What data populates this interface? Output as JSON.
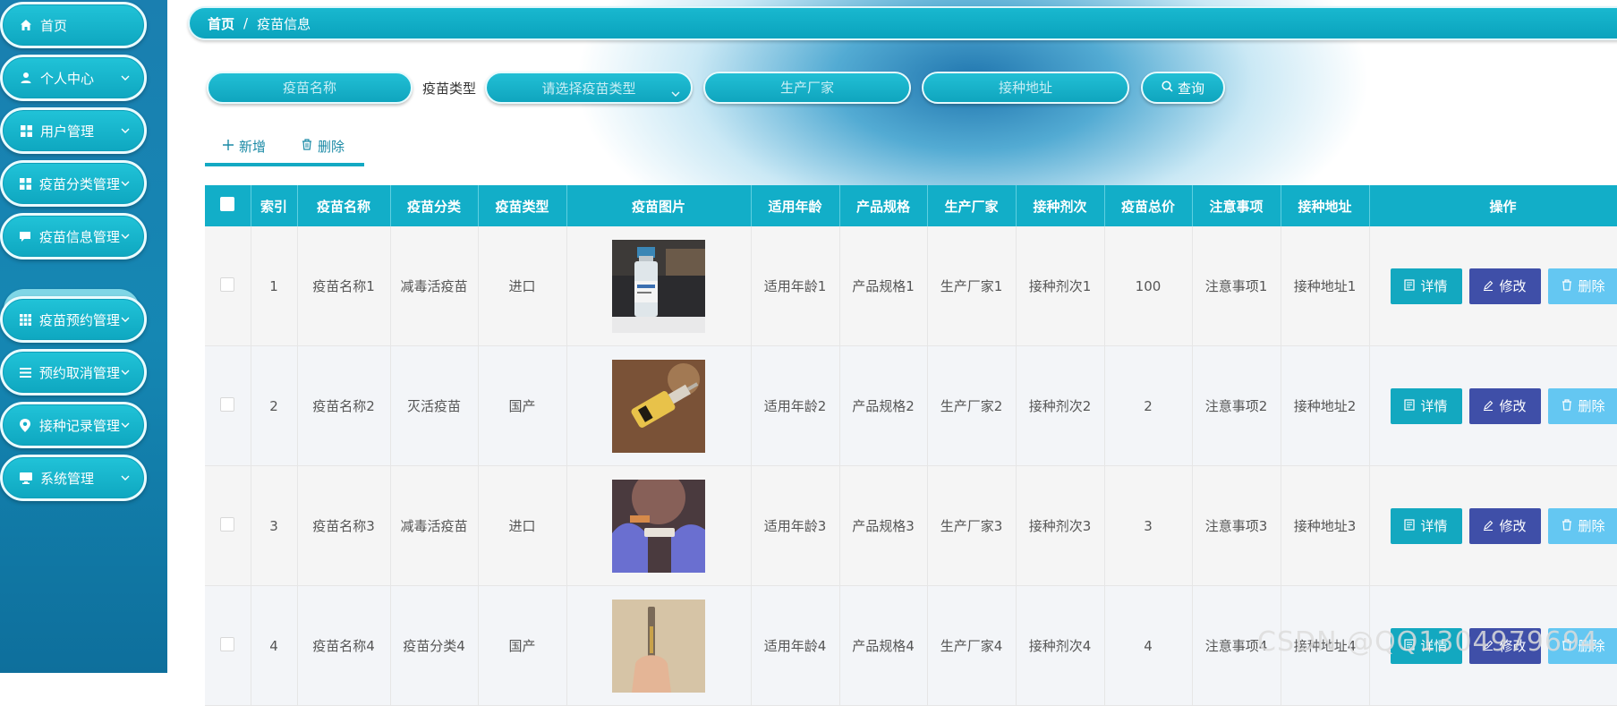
{
  "sidebar": {
    "items": [
      {
        "label": "首页",
        "icon": "home-icon",
        "has_chevron": false
      },
      {
        "label": "个人中心",
        "icon": "user-icon",
        "has_chevron": true
      },
      {
        "label": "用户管理",
        "icon": "grid-icon",
        "has_chevron": true
      },
      {
        "label": "疫苗分类管理",
        "icon": "grid-icon",
        "has_chevron": true
      },
      {
        "label": "疫苗信息管理",
        "icon": "chat-icon",
        "has_chevron": true
      },
      {
        "label": "疫苗预约管理",
        "icon": "grid9-icon",
        "has_chevron": true
      },
      {
        "label": "预约取消管理",
        "icon": "list-icon",
        "has_chevron": true
      },
      {
        "label": "接种记录管理",
        "icon": "pin-icon",
        "has_chevron": true
      },
      {
        "label": "系统管理",
        "icon": "monitor-icon",
        "has_chevron": true
      }
    ],
    "active_sub": "疫苗信息"
  },
  "breadcrumb": {
    "home": "首页",
    "separator": "/",
    "current": "疫苗信息"
  },
  "search": {
    "name_placeholder": "疫苗名称",
    "type_label": "疫苗类型",
    "type_placeholder": "请选择疫苗类型",
    "maker_placeholder": "生产厂家",
    "address_placeholder": "接种地址",
    "button": "查询"
  },
  "toolbar": {
    "add": "新增",
    "delete": "删除"
  },
  "table": {
    "headers": [
      "索引",
      "疫苗名称",
      "疫苗分类",
      "疫苗类型",
      "疫苗图片",
      "适用年龄",
      "产品规格",
      "生产厂家",
      "接种剂次",
      "疫苗总价",
      "注意事项",
      "接种地址",
      "操作"
    ],
    "actions": {
      "detail": "详情",
      "edit": "修改",
      "delete": "删除"
    },
    "rows": [
      {
        "index": "1",
        "name": "疫苗名称1",
        "category": "减毒活疫苗",
        "type": "进口",
        "image": "vaccine-vial-photo",
        "age": "适用年龄1",
        "spec": "产品规格1",
        "maker": "生产厂家1",
        "dose": "接种剂次1",
        "price": "100",
        "notes": "注意事项1",
        "address": "接种地址1"
      },
      {
        "index": "2",
        "name": "疫苗名称2",
        "category": "灭活疫苗",
        "type": "国产",
        "image": "syringe-photo",
        "age": "适用年龄2",
        "spec": "产品规格2",
        "maker": "生产厂家2",
        "dose": "接种剂次2",
        "price": "2",
        "notes": "注意事项2",
        "address": "接种地址2"
      },
      {
        "index": "3",
        "name": "疫苗名称3",
        "category": "减毒活疫苗",
        "type": "进口",
        "image": "gloved-hands-photo",
        "age": "适用年龄3",
        "spec": "产品规格3",
        "maker": "生产厂家3",
        "dose": "接种剂次3",
        "price": "3",
        "notes": "注意事项3",
        "address": "接种地址3"
      },
      {
        "index": "4",
        "name": "疫苗名称4",
        "category": "疫苗分类4",
        "type": "国产",
        "image": "hand-syringe-photo",
        "age": "适用年龄4",
        "spec": "产品规格4",
        "maker": "生产厂家4",
        "dose": "接种剂次4",
        "price": "4",
        "notes": "注意事项4",
        "address": "接种地址4"
      }
    ]
  },
  "watermark": "CSDN @QQ1304979694",
  "colors": {
    "primary": "#12aec8",
    "edit": "#3f4fa8",
    "delete": "#64c7f2"
  }
}
